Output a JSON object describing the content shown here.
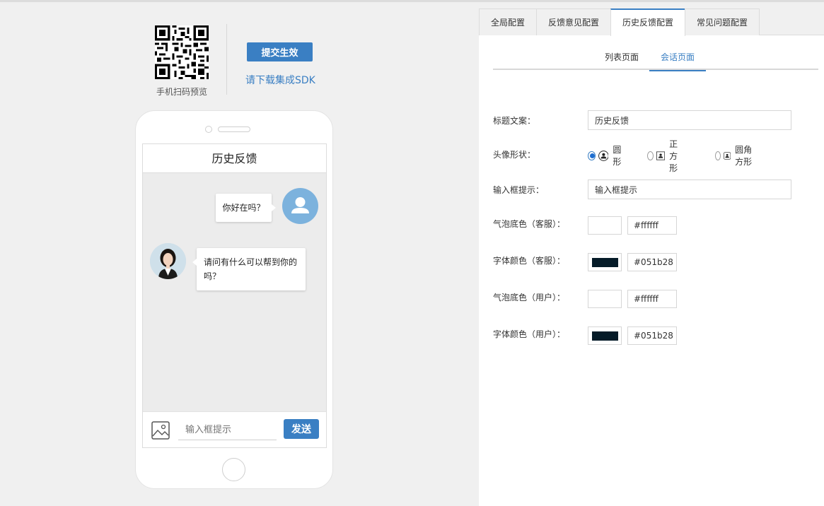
{
  "left": {
    "qr_caption": "手机扫码预览",
    "submit_label": "提交生效",
    "sdk_link": "请下载集成SDK"
  },
  "phone": {
    "header_title": "历史反馈",
    "user_message": "你好在吗？",
    "agent_message": "请问有什么可以帮到你的吗？",
    "input_placeholder": "输入框提示",
    "send_label": "发送"
  },
  "tabs": [
    {
      "label": "全局配置",
      "active": false
    },
    {
      "label": "反馈意见配置",
      "active": false
    },
    {
      "label": "历史反馈配置",
      "active": true
    },
    {
      "label": "常见问题配置",
      "active": false
    }
  ],
  "subtabs": [
    {
      "label": "列表页面",
      "active": false
    },
    {
      "label": "会话页面",
      "active": true
    }
  ],
  "form": {
    "title_label": "标题文案：",
    "title_value": "历史反馈",
    "avatar_shape_label": "头像形状：",
    "avatar_shapes": [
      {
        "label": "圆形",
        "checked": true
      },
      {
        "label": "正方形",
        "checked": false
      },
      {
        "label": "圆角方形",
        "checked": false
      }
    ],
    "input_hint_label": "输入框提示：",
    "input_hint_value": "输入框提示",
    "colors": [
      {
        "label": "气泡底色（客服）：",
        "color": "#ffffff",
        "hex": "#ffffff"
      },
      {
        "label": "字体颜色（客服）：",
        "color": "#051b28",
        "hex": "#051b28"
      },
      {
        "label": "气泡底色（用户）：",
        "color": "#ffffff",
        "hex": "#ffffff"
      },
      {
        "label": "字体颜色（用户）：",
        "color": "#051b28",
        "hex": "#051b28"
      }
    ]
  },
  "theme": {
    "accent": "#3a7fc3",
    "user_avatar_bg": "#7cb2dd"
  }
}
